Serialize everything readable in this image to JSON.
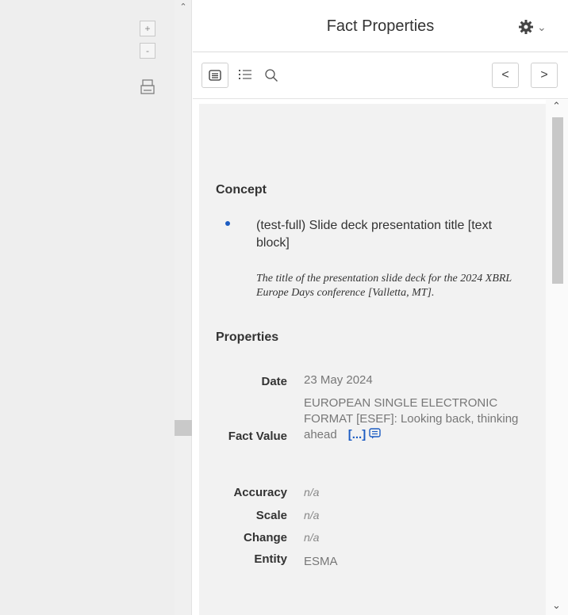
{
  "viewer": {
    "zoom_in_label": "+",
    "zoom_out_label": "-"
  },
  "inspector": {
    "title": "Fact Properties",
    "nav_prev_label": "<",
    "nav_next_label": ">",
    "concept_heading": "Concept",
    "concept_name": "(test-full) Slide deck presentation title [text block]",
    "concept_description": "The title of the presentation slide deck for the 2024 XBRL Europe Days conference [Valletta, MT].",
    "properties_heading": "Properties",
    "properties": {
      "date_label": "Date",
      "date_value": "23 May 2024",
      "fact_value_label": "Fact Value",
      "fact_value": "EUROPEAN SINGLE ELECTRONIC FORMAT [ESEF]: Looking back, thinking ahead",
      "more_link": "[...]",
      "accuracy_label": "Accuracy",
      "accuracy_value": "n/a",
      "scale_label": "Scale",
      "scale_value": "n/a",
      "change_label": "Change",
      "change_value": "n/a",
      "entity_label": "Entity",
      "entity_value": "ESMA"
    }
  },
  "icons": {
    "zoom_in": "plus-icon",
    "zoom_out": "minus-icon",
    "print": "printer-icon",
    "settings": "gear-icon",
    "settings_menu": "chevron-down-icon",
    "view_document": "document-icon",
    "view_outline": "outline-list-icon",
    "search": "search-icon",
    "comment": "comment-icon"
  },
  "colors": {
    "link": "#1c5cc2",
    "panel_background": "#f2f2f2",
    "viewer_background": "#eeeeee"
  }
}
